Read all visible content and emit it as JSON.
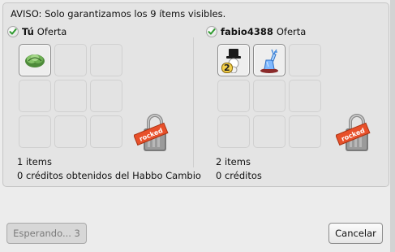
{
  "warning": {
    "text": "AVISO: Solo garantizamos los 9 ítems visibles."
  },
  "my_offer": {
    "user": "Tú",
    "offer_label": "Oferta",
    "items": [
      {
        "icon": "cabbage-icon",
        "filled": true
      },
      {
        "filled": false
      },
      {
        "filled": false
      },
      {
        "filled": false
      },
      {
        "filled": false
      },
      {
        "filled": false
      },
      {
        "filled": false
      },
      {
        "filled": false
      },
      {
        "filled": false
      }
    ],
    "lock_text": "rocked",
    "item_count": "1 items",
    "credits": "0 créditos obtenidos del Habbo Cambio"
  },
  "their_offer": {
    "user": "fabio4388",
    "offer_label": "Oferta",
    "items": [
      {
        "icon": "snowman-icon",
        "filled": true,
        "badge": "2"
      },
      {
        "icon": "crystal-deer-icon",
        "filled": true
      },
      {
        "filled": false
      },
      {
        "filled": false
      },
      {
        "filled": false
      },
      {
        "filled": false
      },
      {
        "filled": false
      },
      {
        "filled": false
      },
      {
        "filled": false
      }
    ],
    "lock_text": "rocked",
    "item_count": "2 items",
    "credits": "0 créditos"
  },
  "buttons": {
    "waiting": "Esperando... 3",
    "cancel": "Cancelar"
  },
  "colors": {
    "lock_tag": "#e8502a",
    "check": "#2f9a2f"
  }
}
